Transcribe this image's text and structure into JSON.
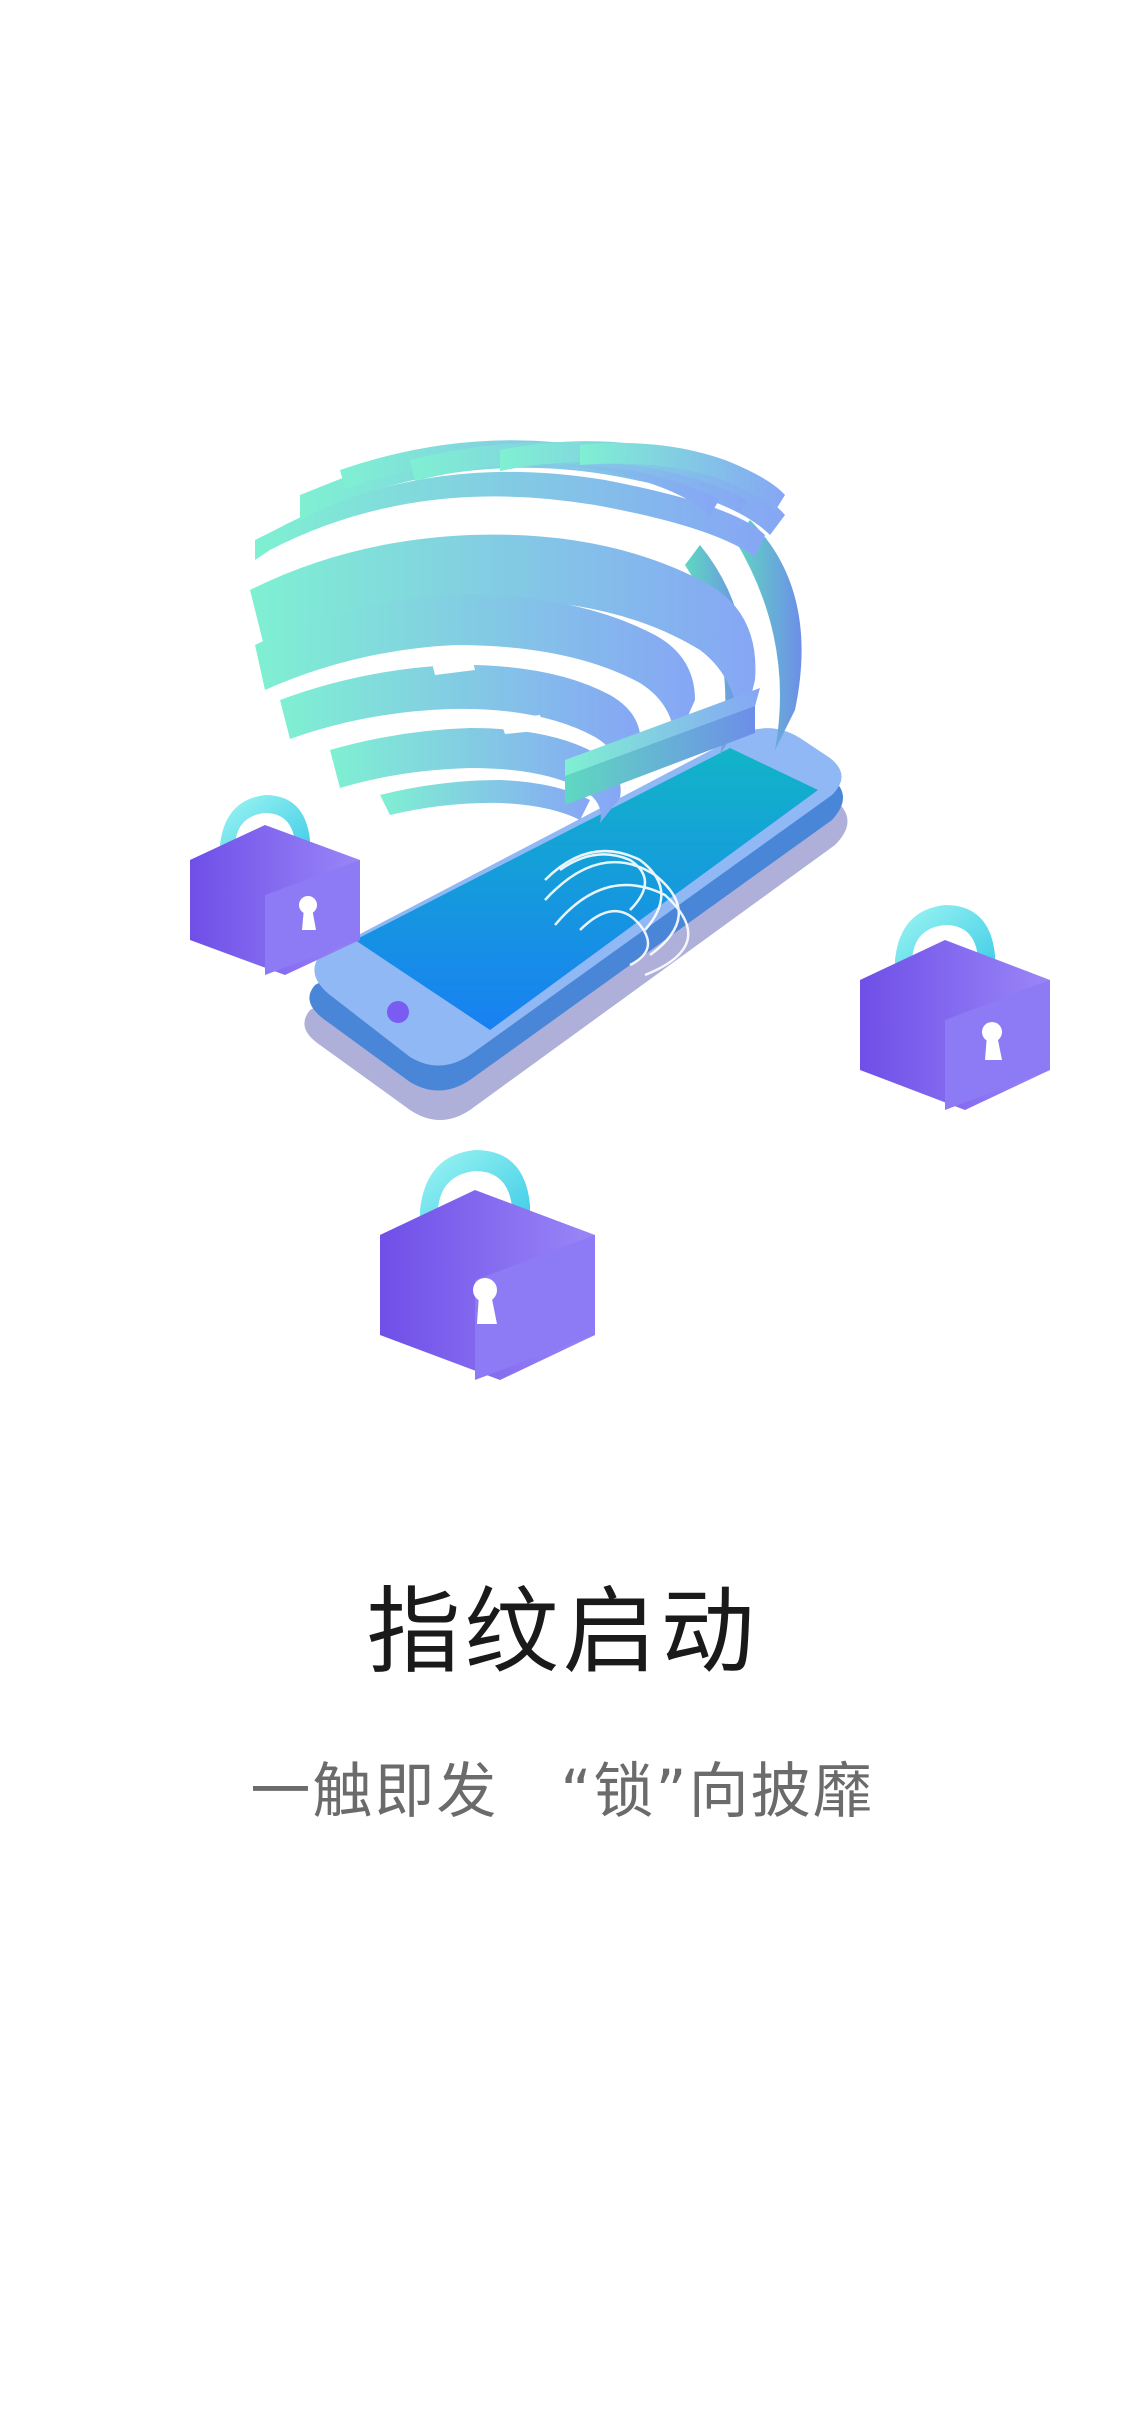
{
  "intro": {
    "title": "指纹启动",
    "subtitle": "一触即发　“锁”向披靡"
  },
  "illustration": {
    "icons": [
      "fingerprint-icon",
      "smartphone-icon",
      "padlock-icon"
    ],
    "colors": {
      "fingerprint_start": "#7ff0d2",
      "fingerprint_end": "#86a6f5",
      "phone_body": "#8fb8f4",
      "phone_screen_top": "#12b4c8",
      "phone_screen_bottom": "#1880f2",
      "lock_body": "#7a5cf2",
      "lock_shackle": "#5fe0ea"
    }
  }
}
